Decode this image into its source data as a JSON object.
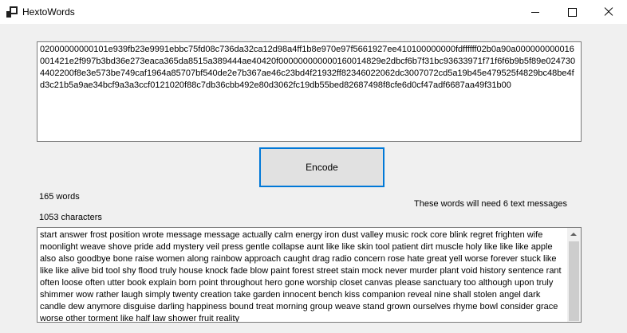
{
  "window": {
    "title": "HextoWords",
    "minimize_icon": "minimize-icon",
    "maximize_icon": "maximize-icon",
    "close_icon": "close-icon"
  },
  "hex_input": {
    "value": "02000000000101e939fb23e9991ebbc75fd08c736da32ca12d98a4ff1b8e970e97f5661927ee410100000000fdffffff02b0a90a000000000016001421e2f997b3bd36e273eaca365da8515a389444ae40420f000000000000160014829e2dbcf6b7f31bc93633971f71f6f6b9b5f89e0247304402200f8e3e573be749caf1964a85707bf540de2e7b367ae46c23bd4f21932ff82346022062dc3007072cd5a19b45e479525f4829bc48be4fd3c21b5a9ae34bcf9a3a3ccf0121020f88c7db36cbb492e80d3062fc19db55bed82687498f8cfe6d0cf47adf6687aa49f31b00"
  },
  "encode_button": {
    "label": "Encode"
  },
  "stats": {
    "word_count": "165 words",
    "char_count": "1053 characters",
    "messages_note": "These words will need 6 text messages"
  },
  "words_output": {
    "text": "start answer frost position wrote message message actually calm energy iron dust valley music rock core blink regret frighten wife moonlight weave shove pride add mystery veil press gentle collapse aunt like like skin tool patient dirt muscle holy like like like apple also also goodbye bone raise women along rainbow approach caught drag radio concern rose hate great yell worse forever stuck like like like alive bid tool shy flood truly house knock fade blow paint forest street stain mock never murder plant void history sentence rant often loose often utter book explain born point throughout hero gone worship closet canvas please sanctuary too although upon truly shimmer wow rather laugh simply twenty creation take garden innocent bench kiss companion reveal nine shall stolen angel dark candle dew anymore disguise darling happiness bound treat morning group weave stand grown ourselves rhyme bowl consider grace worse other torment like half law shower fruit reality"
  }
}
